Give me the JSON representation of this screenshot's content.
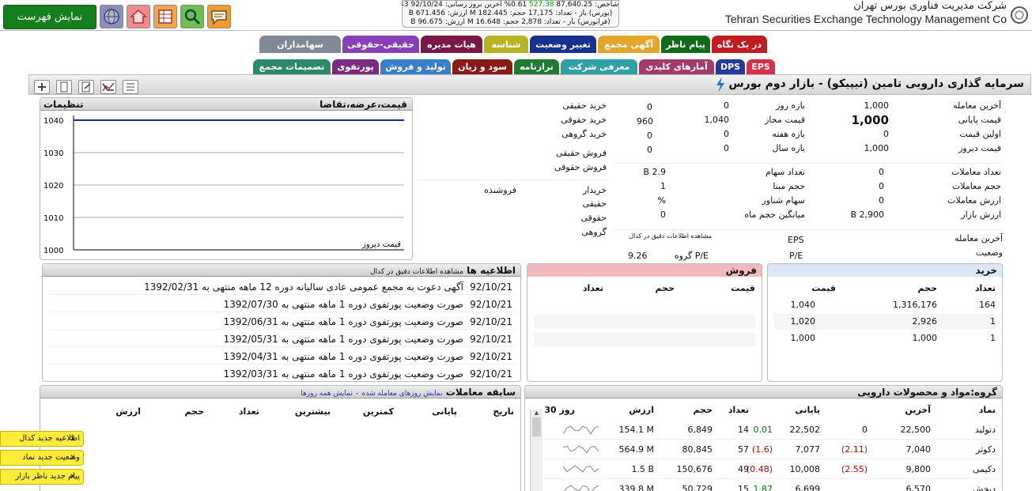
{
  "header": {
    "company_fa": "شرکت مدیریت فناوری بورس تهران",
    "company_en": "Tehran Securities Exchange Technology Management Co",
    "show_list": "نمایش فهرست",
    "ticker_line1": "شاخص: 87,640.25",
    "ticker_line1b": "527.38",
    "ticker_line1c": "0.61% آخرین بروز رسانی: 92/10/24 09:25:43",
    "ticker_line2": "(بورس) باز - تعداد: 17,175 حجم: 182.445 M ارزش: 671.456 B",
    "ticker_line3": "(فرابورس) باز - تعداد: 2,878 حجم: 16.648 M ارزش: 96.675 B"
  },
  "tabs_row1": [
    {
      "label": "در یک نگاه",
      "color": "#c21b22"
    },
    {
      "label": "پیام ناظر",
      "color": "#0f6b1a"
    },
    {
      "label": "آگهی مجمع",
      "color": "#e4a62a"
    },
    {
      "label": "تغییر وضعیت",
      "color": "#17318f"
    },
    {
      "label": "شناسه",
      "color": "#b7b325"
    },
    {
      "label": "هیات مدیره",
      "color": "#7a1747"
    },
    {
      "label": "حقیقی-حقوقی",
      "color": "#8a3fb8"
    },
    {
      "label": "سهامداران",
      "color": "#7e8896"
    }
  ],
  "tabs_row2": [
    {
      "label": "EPS",
      "color": "#d62e4b"
    },
    {
      "label": "DPS",
      "color": "#243a9b"
    },
    {
      "label": "آمارهای کلیدی",
      "color": "#a23a6a"
    },
    {
      "label": "معرفی شرکت",
      "color": "#2fa1a4"
    },
    {
      "label": "ترازنامه",
      "color": "#1f7a33"
    },
    {
      "label": "سود و زیان",
      "color": "#8a1a1a"
    },
    {
      "label": "تولید و فروش",
      "color": "#3a7fc9"
    },
    {
      "label": "پورتفوی",
      "color": "#7a2b7f"
    },
    {
      "label": "تصمیمات مجمع",
      "color": "#2a8a6a"
    }
  ],
  "symbol_title": "سرمایه گذاری دارویی تامین (تیپیکو) - بازار دوم بورس",
  "stats1": [
    {
      "label": "آخرین معامله",
      "value": "1,000"
    },
    {
      "label": "قیمت پایانی",
      "value": "1,000"
    },
    {
      "label": "اولین قیمت",
      "value": "0"
    },
    {
      "label": "قیمت دیروز",
      "value": "1,000"
    }
  ],
  "stats2": [
    {
      "label": "بازه روز",
      "a": "0",
      "b": "0"
    },
    {
      "label": "قیمت مجاز",
      "a": "1,040",
      "b": "960"
    },
    {
      "label": "بازه هفته",
      "a": "0",
      "b": "0"
    },
    {
      "label": "بازه سال",
      "a": "0",
      "b": "0"
    }
  ],
  "stats3": [
    {
      "label": "تعداد معاملات",
      "value": "0"
    },
    {
      "label": "حجم معاملات",
      "value": "0"
    },
    {
      "label": "ارزش معاملات",
      "value": "0"
    },
    {
      "label": "ارزش بازار",
      "value": "2,900 B"
    }
  ],
  "stats4": [
    {
      "label": "تعداد سهام",
      "value": "2.9 B"
    },
    {
      "label": "حجم مبنا",
      "value": "1"
    },
    {
      "label": "سهام شناور",
      "value": "%"
    },
    {
      "label": "میانگین حجم ماه",
      "value": "0"
    }
  ],
  "stats5": [
    {
      "label": "آخرین معامله",
      "value": "EPS"
    },
    {
      "label": "وضعیت",
      "value": "P/E"
    }
  ],
  "pe_group_label": "P/E گروه",
  "pe_group_value": "9.26",
  "kodal_note": "مشاهده اطلاعات دقیق در کدال",
  "realbuy": [
    {
      "label": "خرید حقیقی",
      "value": "0"
    },
    {
      "label": "خرید حقوقی",
      "value": "0"
    },
    {
      "label": "خرید گروهی",
      "value": ""
    },
    {
      "label": "فروش حقیقی",
      "value": ""
    },
    {
      "label": "فروش حقوقی",
      "value": ""
    }
  ],
  "buyer_seller": {
    "buyer": "خریدار",
    "seller": "فروشنده",
    "rows": [
      "حقیقی",
      "حقوقی",
      "گروهی"
    ]
  },
  "chart_title": "قیمت،عرضه،تقاضا",
  "chart_settings": "تنظیمات",
  "chart_yesterday": "قیمت دیروز",
  "chart_data": {
    "type": "line",
    "yticks": [
      1000,
      1010,
      1020,
      1030,
      1040
    ],
    "ylim": [
      1000,
      1040
    ],
    "series": [
      {
        "values": [
          1040,
          1040
        ]
      }
    ]
  },
  "news": {
    "title": "اطلاعیه ها",
    "sub": "مشاهده اطلاعات دقیق در کدال",
    "items": [
      {
        "date": "92/10/21",
        "text": "آگهی دعوت به مجمع عمومی عادی سالیانه دوره 12 ماهه منتهی به 1392/02/31"
      },
      {
        "date": "92/10/21",
        "text": "صورت وضعیت پورتفوی دوره 1 ماهه منتهی به 1392/07/30"
      },
      {
        "date": "92/10/21",
        "text": "صورت وضعیت پورتفوی دوره 1 ماهه منتهی به 1392/06/31"
      },
      {
        "date": "92/10/21",
        "text": "صورت وضعیت پورتفوی دوره 1 ماهه منتهی به 1392/05/31"
      },
      {
        "date": "92/10/21",
        "text": "صورت وضعیت پورتفوی دوره 1 ماهه منتهی به 1392/04/31"
      },
      {
        "date": "92/10/21",
        "text": "صورت وضعیت پورتفوی دوره 1 ماهه منتهی به 1392/03/31"
      }
    ]
  },
  "sell": {
    "title": "فروش",
    "cols": [
      "قیمت",
      "حجم",
      "تعداد"
    ]
  },
  "buy": {
    "title": "خرید",
    "cols": [
      "تعداد",
      "حجم",
      "قیمت"
    ],
    "rows": [
      [
        "164",
        "1,316,176",
        "1,040"
      ],
      [
        "1",
        "2,926",
        "1,020"
      ],
      [
        "1",
        "1,000",
        "1,000"
      ]
    ]
  },
  "history": {
    "title": "سابقه معاملات",
    "link1": "نمایش روزهای معامله شده",
    "sep": "-",
    "link2": "نمایش همه روزها",
    "cols": [
      "تاریخ",
      "پایانی",
      "کمترین",
      "بیشترین",
      "تعداد",
      "حجم",
      "ارزش"
    ]
  },
  "group": {
    "title": "گروه:مواد و محصولات دارویی",
    "cols": [
      "نماد",
      "آخرین",
      "",
      "پایانی",
      "",
      "تعداد",
      "حجم",
      "ارزش",
      "30 روز"
    ],
    "rows": [
      {
        "sym": "دتولید",
        "last": "22,500",
        "lchg": "0",
        "final": "22,502",
        "fchg": "0.01",
        "cnt": "14",
        "vol": "6,849",
        "val": "154.1 M"
      },
      {
        "sym": "دکوثر",
        "last": "7,040",
        "lchg": "(2.11)",
        "final": "7,077",
        "fchg": "(1.6)",
        "cnt": "57",
        "vol": "80,845",
        "val": "564.9 M"
      },
      {
        "sym": "دکیمی",
        "last": "9,800",
        "lchg": "(2.55)",
        "final": "10,008",
        "fchg": "(0.48)",
        "cnt": "49",
        "vol": "150,676",
        "val": "1.5 B"
      },
      {
        "sym": "دپخش",
        "last": "6,570",
        "lchg": "",
        "final": "6,699",
        "fchg": "1.87",
        "cnt": "15",
        "vol": "50,729",
        "val": "339.8 M"
      }
    ]
  },
  "notices": [
    {
      "text": "اطلاعیه جدید کدال",
      "x": "x"
    },
    {
      "text": "وضعیت جدید نماد",
      "x": "x"
    },
    {
      "text": "پیام جدید ناظر بازار",
      "x": "x"
    }
  ]
}
